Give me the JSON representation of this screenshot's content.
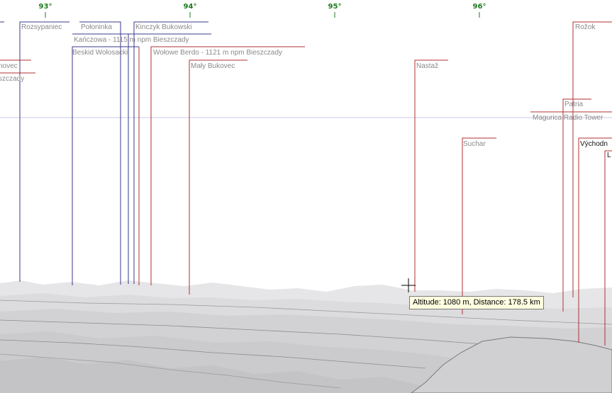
{
  "colors": {
    "degree_tick": "#1e7a1e",
    "horizon_line": "#c9c9e8",
    "stroke_red": "#b03030",
    "stroke_blue": "#38388c",
    "label_gray": "#8a8a8a",
    "label_black": "#111111",
    "terrain_far": "#e4e4e6",
    "terrain_mid": "#d4d4d6",
    "terrain_near": "#c6c6c8",
    "rock": "#cfcfd1"
  },
  "degree_ticks": [
    "93°",
    "94°",
    "95°",
    "96°"
  ],
  "peaks": [
    "Rozsypaniec",
    "Połoninka",
    "Kinczyk Bukowski",
    "Kańczowa - 1115 m npm Bieszczady",
    "Beskid Wołosacki",
    "Wołowe Berdo - 1121 m npm Bieszczady",
    "Mały Bukovec",
    "Nastaž",
    "Suchar",
    "Rožok",
    "Patria",
    "Magurica Radio Tower",
    "Východn",
    "L",
    "novec",
    "szczady"
  ],
  "cursor_icon": "crosshair-icon",
  "tooltip": "Altitude: 1080 m, Distance: 178.5 km"
}
